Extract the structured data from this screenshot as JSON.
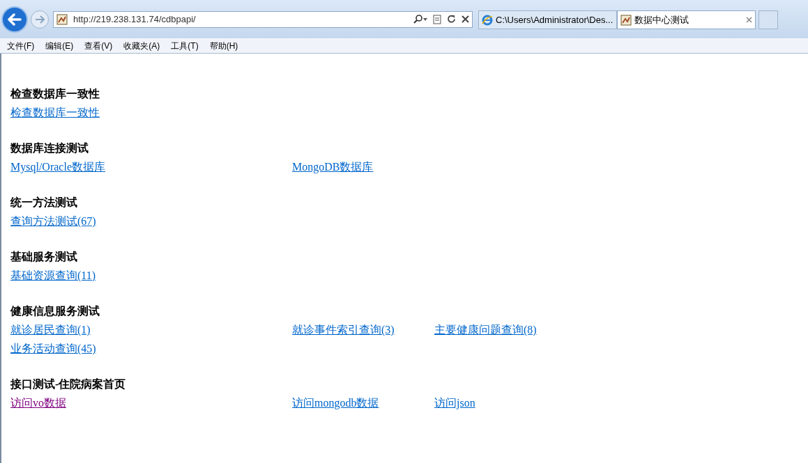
{
  "address_bar": {
    "url": "http://219.238.131.74/cdbpapi/"
  },
  "tabs": [
    {
      "title": "C:\\Users\\Administrator\\Des...",
      "selected": false,
      "kind": "ie"
    },
    {
      "title": "数据中心测试",
      "selected": true,
      "kind": "page"
    }
  ],
  "menu": [
    "文件(F)",
    "编辑(E)",
    "查看(V)",
    "收藏夹(A)",
    "工具(T)",
    "帮助(H)"
  ],
  "sections": [
    {
      "heading": "检查数据库一致性",
      "links": [
        {
          "text": "检查数据库一致性",
          "visited": false
        }
      ]
    },
    {
      "heading": "数据库连接测试",
      "links": [
        {
          "text": "Mysql/Oracle数据库",
          "visited": false
        },
        {
          "text": "MongoDB数据库",
          "visited": false
        }
      ]
    },
    {
      "heading": "统一方法测试",
      "links": [
        {
          "text": "查询方法测试(67)",
          "visited": false
        }
      ]
    },
    {
      "heading": "基础服务测试",
      "links": [
        {
          "text": "基础资源查询(11)",
          "visited": false
        }
      ]
    },
    {
      "heading": "健康信息服务测试",
      "links": [
        {
          "text": "就诊居民查询(1)",
          "visited": false
        },
        {
          "text": "就诊事件索引查询(3)",
          "visited": false
        },
        {
          "text": "主要健康问题查询(8)",
          "visited": false
        },
        {
          "text": "业务活动查询(45)",
          "visited": false
        }
      ]
    },
    {
      "heading": "接口测试-住院病案首页",
      "links": [
        {
          "text": "访问vo数据",
          "visited": true
        },
        {
          "text": "访问mongodb数据",
          "visited": false
        },
        {
          "text": "访问json",
          "visited": false
        }
      ]
    }
  ]
}
